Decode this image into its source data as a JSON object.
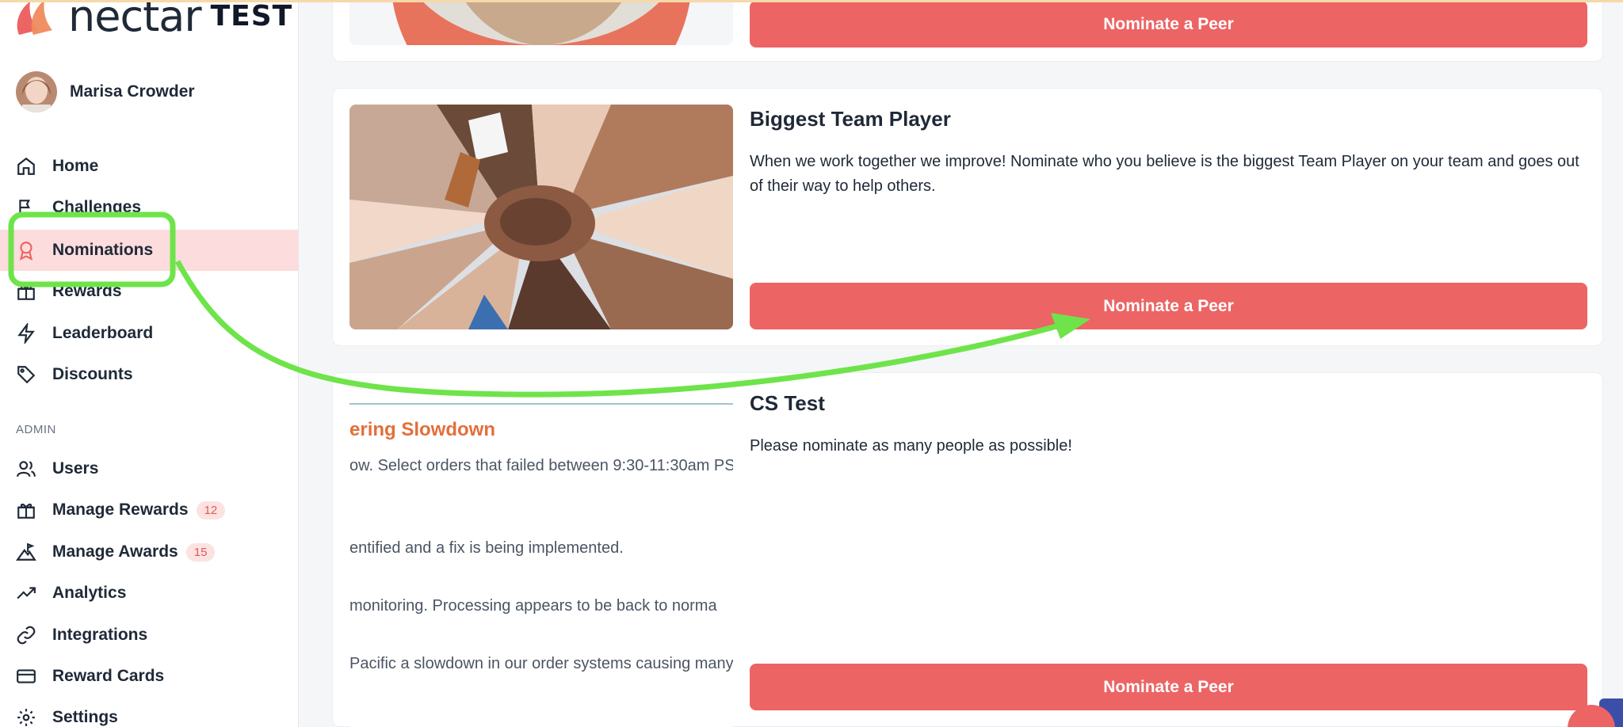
{
  "app": {
    "logo_text": "nectar",
    "logo_tag": "TEST",
    "brand_color": "#ec6464"
  },
  "user": {
    "name": "Marisa Crowder"
  },
  "sidebar": {
    "items": [
      {
        "label": "Home",
        "icon": "home-icon"
      },
      {
        "label": "Challenges",
        "icon": "flag-icon"
      },
      {
        "label": "Nominations",
        "icon": "award-icon",
        "active": true
      },
      {
        "label": "Rewards",
        "icon": "gift-icon"
      },
      {
        "label": "Leaderboard",
        "icon": "lightning-icon"
      },
      {
        "label": "Discounts",
        "icon": "tag-icon"
      }
    ],
    "admin_label": "ADMIN",
    "admin_items": [
      {
        "label": "Users",
        "icon": "users-icon"
      },
      {
        "label": "Manage Rewards",
        "icon": "gift-icon",
        "badge": "12"
      },
      {
        "label": "Manage Awards",
        "icon": "mountain-flag-icon",
        "badge": "15"
      },
      {
        "label": "Analytics",
        "icon": "trending-up-icon"
      },
      {
        "label": "Integrations",
        "icon": "link-icon"
      },
      {
        "label": "Reward Cards",
        "icon": "credit-card-icon"
      },
      {
        "label": "Settings",
        "icon": "gear-icon"
      }
    ]
  },
  "cards": [
    {
      "button_label": "Nominate a Peer"
    },
    {
      "title": "Biggest Team Player",
      "description": "When we work together we improve! Nominate who you believe is the biggest Team Player on your team and goes out of their way to help others.",
      "button_label": "Nominate a Peer"
    },
    {
      "title": "CS Test",
      "description": "Please nominate as many people as possible!",
      "button_label": "Nominate a Peer",
      "image_lines": [
        "ering Slowdown",
        "ow. Select orders that failed between 9:30-11:30am PS",
        "entified and a fix is being implemented.",
        "monitoring. Processing appears to be back to norma",
        "Pacific a slowdown in our order systems causing many"
      ]
    }
  ],
  "annotation": {
    "color": "#6ee44a"
  }
}
